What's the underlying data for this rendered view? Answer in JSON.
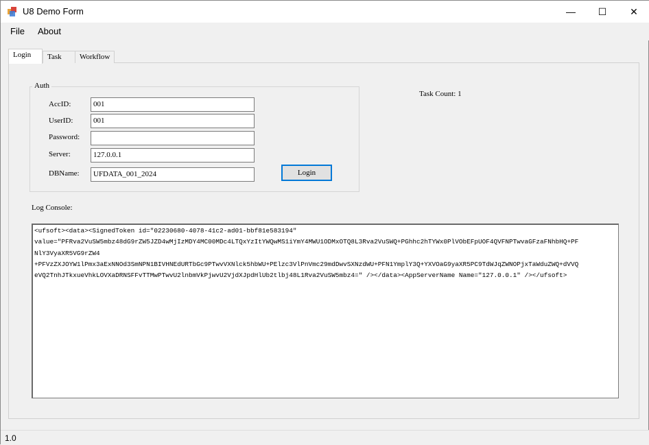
{
  "window": {
    "title": "U8 Demo Form",
    "minimize": "—",
    "maximize": "☐",
    "close": "✕"
  },
  "menu": [
    "File",
    "About"
  ],
  "tabs": [
    "Login",
    "Task",
    "Workflow"
  ],
  "auth": {
    "group_label": "Auth",
    "fields": [
      {
        "label": "AccID:",
        "value": "001"
      },
      {
        "label": "UserID:",
        "value": "001"
      },
      {
        "label": "Password:",
        "value": ""
      },
      {
        "label": "Server:",
        "value": "127.0.0.1"
      },
      {
        "label": "DBName:",
        "value": "UFDATA_001_2024"
      }
    ],
    "login_button": "Login"
  },
  "task_count": "Task Count: 1",
  "log_label": "Log Console:",
  "log_text": "<ufsoft><data><SignedToken id=\"02230680-4078-41c2-ad01-bbf81e583194\"\nvalue=\"PFRva2VuSW5mbz48dG9rZW5JZD4wMjIzMDY4MC00MDc4LTQxYzItYWQwMS1iYmY4MWU1ODMxOTQ8L3Rva2VuSWQ+PGhhc2hTYWx0PlVObEFpUOF4QVFNPTwvaGFzaFNhbHQ+PF\nNlY3VyaXR5VG9rZW4\n+PFVzZXJOYW1lPmx3aExNNOd3SmNPN1BIVHNEdURTbGc9PTwvVXNlck5hbWU+PElzc3VlPnVmc29mdDwvSXNzdWU+PFN1YmplY3Q+YXVOaG9yaXR5PC9TdWJqZWNOPjxTaWduZWQ+dVVQ\neVQ2TnhJTkxueVhkLOVXaDRNSFFvTTMwPTwvU2lnbmVkPjwvU2VjdXJpdHlUb2tlbj48L1Rva2VuSW5mbz4=\" /></data><AppServerName Name=\"127.0.0.1\" /></ufsoft>",
  "status": "1.0"
}
